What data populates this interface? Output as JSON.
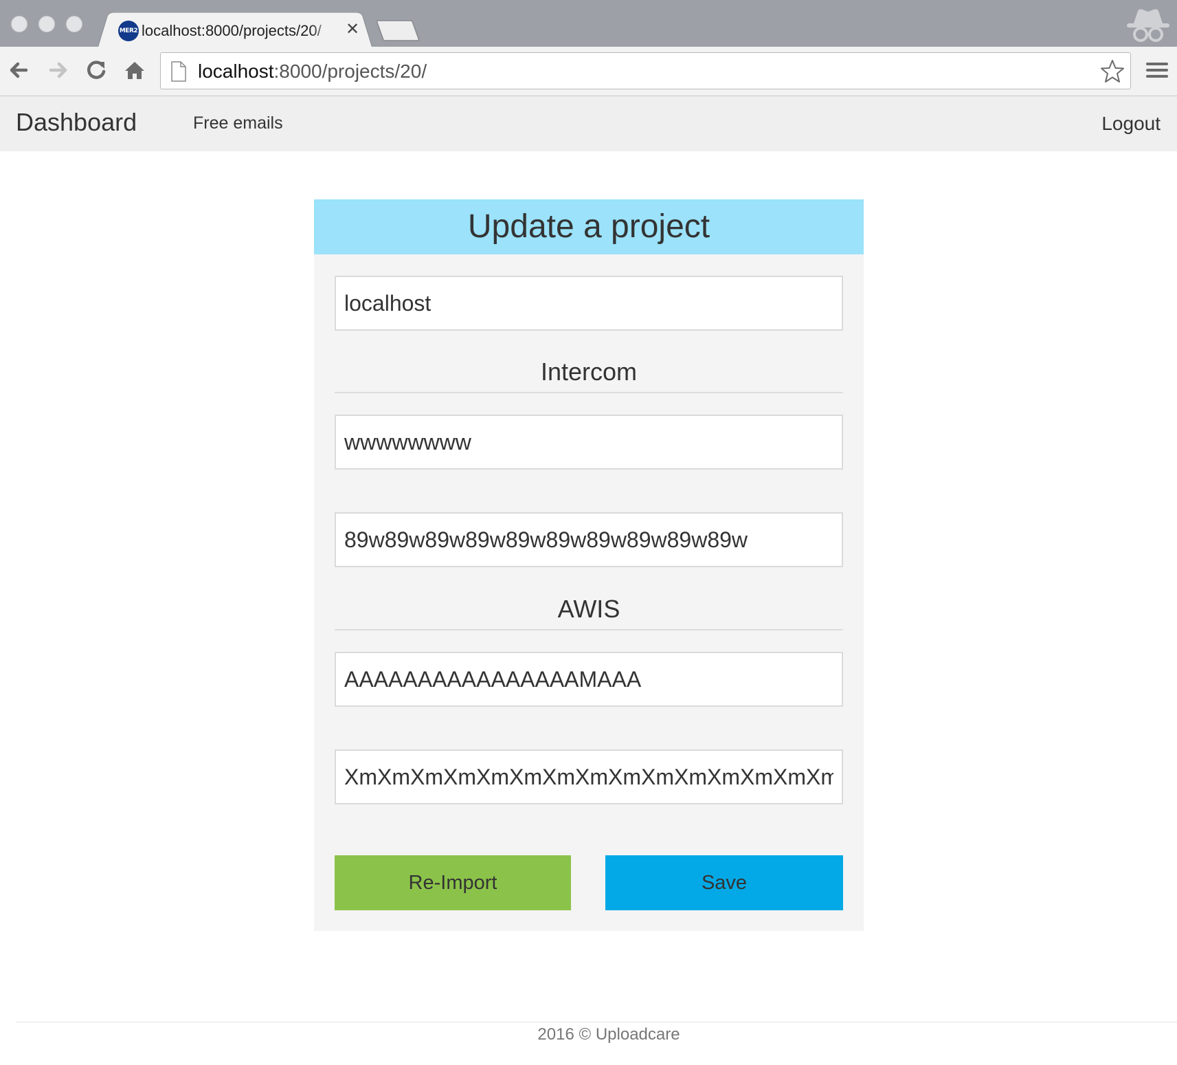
{
  "browser": {
    "tab": {
      "favicon_text": "MER2",
      "title": "localhost:8000/projects/20/",
      "close_glyph": "✕"
    },
    "address_bar": {
      "host": "localhost",
      "rest": ":8000/projects/20/"
    },
    "icons": {
      "back": "back-arrow-icon",
      "forward": "forward-arrow-icon",
      "reload": "reload-icon",
      "home": "home-icon",
      "page": "page-icon",
      "bookmark": "star-icon",
      "menu": "hamburger-menu-icon",
      "incognito": "incognito-icon"
    }
  },
  "navbar": {
    "brand": "Dashboard",
    "links": [
      {
        "label": "Free emails"
      }
    ],
    "logout": "Logout"
  },
  "form": {
    "title": "Update a project",
    "name_value": "localhost",
    "sections": [
      {
        "title": "Intercom",
        "fields": [
          {
            "value": "wwwwwwww"
          },
          {
            "value": "89w89w89w89w89w89w89w89w89w89w"
          }
        ]
      },
      {
        "title": "AWIS",
        "fields": [
          {
            "value": "AAAAAAAAAAAAAAAAMAAA"
          },
          {
            "value": "XmXmXmXmXmXmXmXmXmXmXmXmXmXmXm"
          }
        ]
      }
    ],
    "buttons": {
      "reimport": "Re-Import",
      "save": "Save"
    }
  },
  "footer": {
    "text": "2016 © Uploadcare"
  },
  "colors": {
    "header_bg": "#9be2fa",
    "reimport_bg": "#8bc34a",
    "save_bg": "#03a9e6",
    "navbar_bg": "#efefef",
    "panel_bg": "#f4f4f4"
  }
}
